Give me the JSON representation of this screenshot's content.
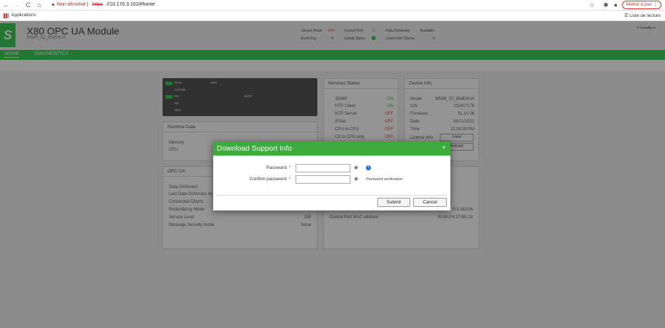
{
  "browser": {
    "security_warning": "Non sécurisé",
    "url_scheme": "https",
    "url_rest": "://10.170.3.102/#home",
    "update_button": "Mettre à jour",
    "bookmarks_apps": "Applications",
    "reading_list": "Liste de lecture"
  },
  "app": {
    "title": "X80 OPC UA Module",
    "subtitle": "M58R_S2_BMENUA",
    "user": "installer",
    "status": {
      "secure_mode_label": "Secure Mode",
      "secure_mode_value": "OFF",
      "event_log_label": "Event log",
      "control_port_label": "Control Port",
      "global_status_label": "Global Status",
      "data_dictionary_label": "Data Dictionary",
      "data_dictionary_value": "Available",
      "connected_clients_label": "Connected Clients",
      "connected_clients_value": "0"
    },
    "tabs": [
      "HOME",
      "DIAGNOSTICS"
    ]
  },
  "leds": {
    "run": "RUN",
    "err": "ERR",
    "uaonk": "UAONK",
    "bs": "BS",
    "busy": "BUSY",
    "ns": "NS",
    "sec": "SEC"
  },
  "runtime": {
    "title": "Runtime Data",
    "memory": "Memory",
    "cpu": "CPU"
  },
  "opcua": {
    "title": "OPC UA",
    "rows": [
      {
        "label": "Data Dictionary",
        "value": ""
      },
      {
        "label": "Last Data Dictionary Ac",
        "value": ""
      },
      {
        "label": "Connected Clients",
        "value": ""
      },
      {
        "label": "Redundancy Mode",
        "value": ""
      },
      {
        "label": "Service Level",
        "value": "255"
      },
      {
        "label": "Message Security mode",
        "value": "None"
      }
    ]
  },
  "services": {
    "title": "Services Status",
    "rows": [
      {
        "label": "SNMP",
        "value": "ON"
      },
      {
        "label": "NTP Client",
        "value": "ON"
      },
      {
        "label": "NTP Server",
        "value": "OFF"
      },
      {
        "label": "IPSec",
        "value": "OFF"
      },
      {
        "label": "CPU to CPU",
        "value": "OFF"
      },
      {
        "label": "CE to CPU only",
        "value": "OFF"
      }
    ]
  },
  "device": {
    "title": "Device Info",
    "rows": [
      {
        "label": "Model",
        "value": "M58B_S2_BMENUA"
      },
      {
        "label": "S/N",
        "value": "211907178"
      },
      {
        "label": "Firmware",
        "value": "01.10.26"
      },
      {
        "label": "Date",
        "value": "09/21/2021"
      },
      {
        "label": "Time",
        "value": "11:04:28 PM"
      }
    ],
    "license_label": "License Info",
    "view_button": "View",
    "reset_button": "Reboot"
  },
  "network": {
    "rows": [
      {
        "label": "",
        "value": "0.3.182/16"
      },
      {
        "label": "Control Port MAC address",
        "value": "00:80:F4:27:BE:22"
      }
    ]
  },
  "modal": {
    "title": "Download Support Info",
    "close": "×",
    "password_label": "Password:",
    "confirm_label": "Confirm password:",
    "required_mark": "*",
    "hint": "Password verification",
    "submit": "Submit",
    "cancel": "Cancel"
  }
}
